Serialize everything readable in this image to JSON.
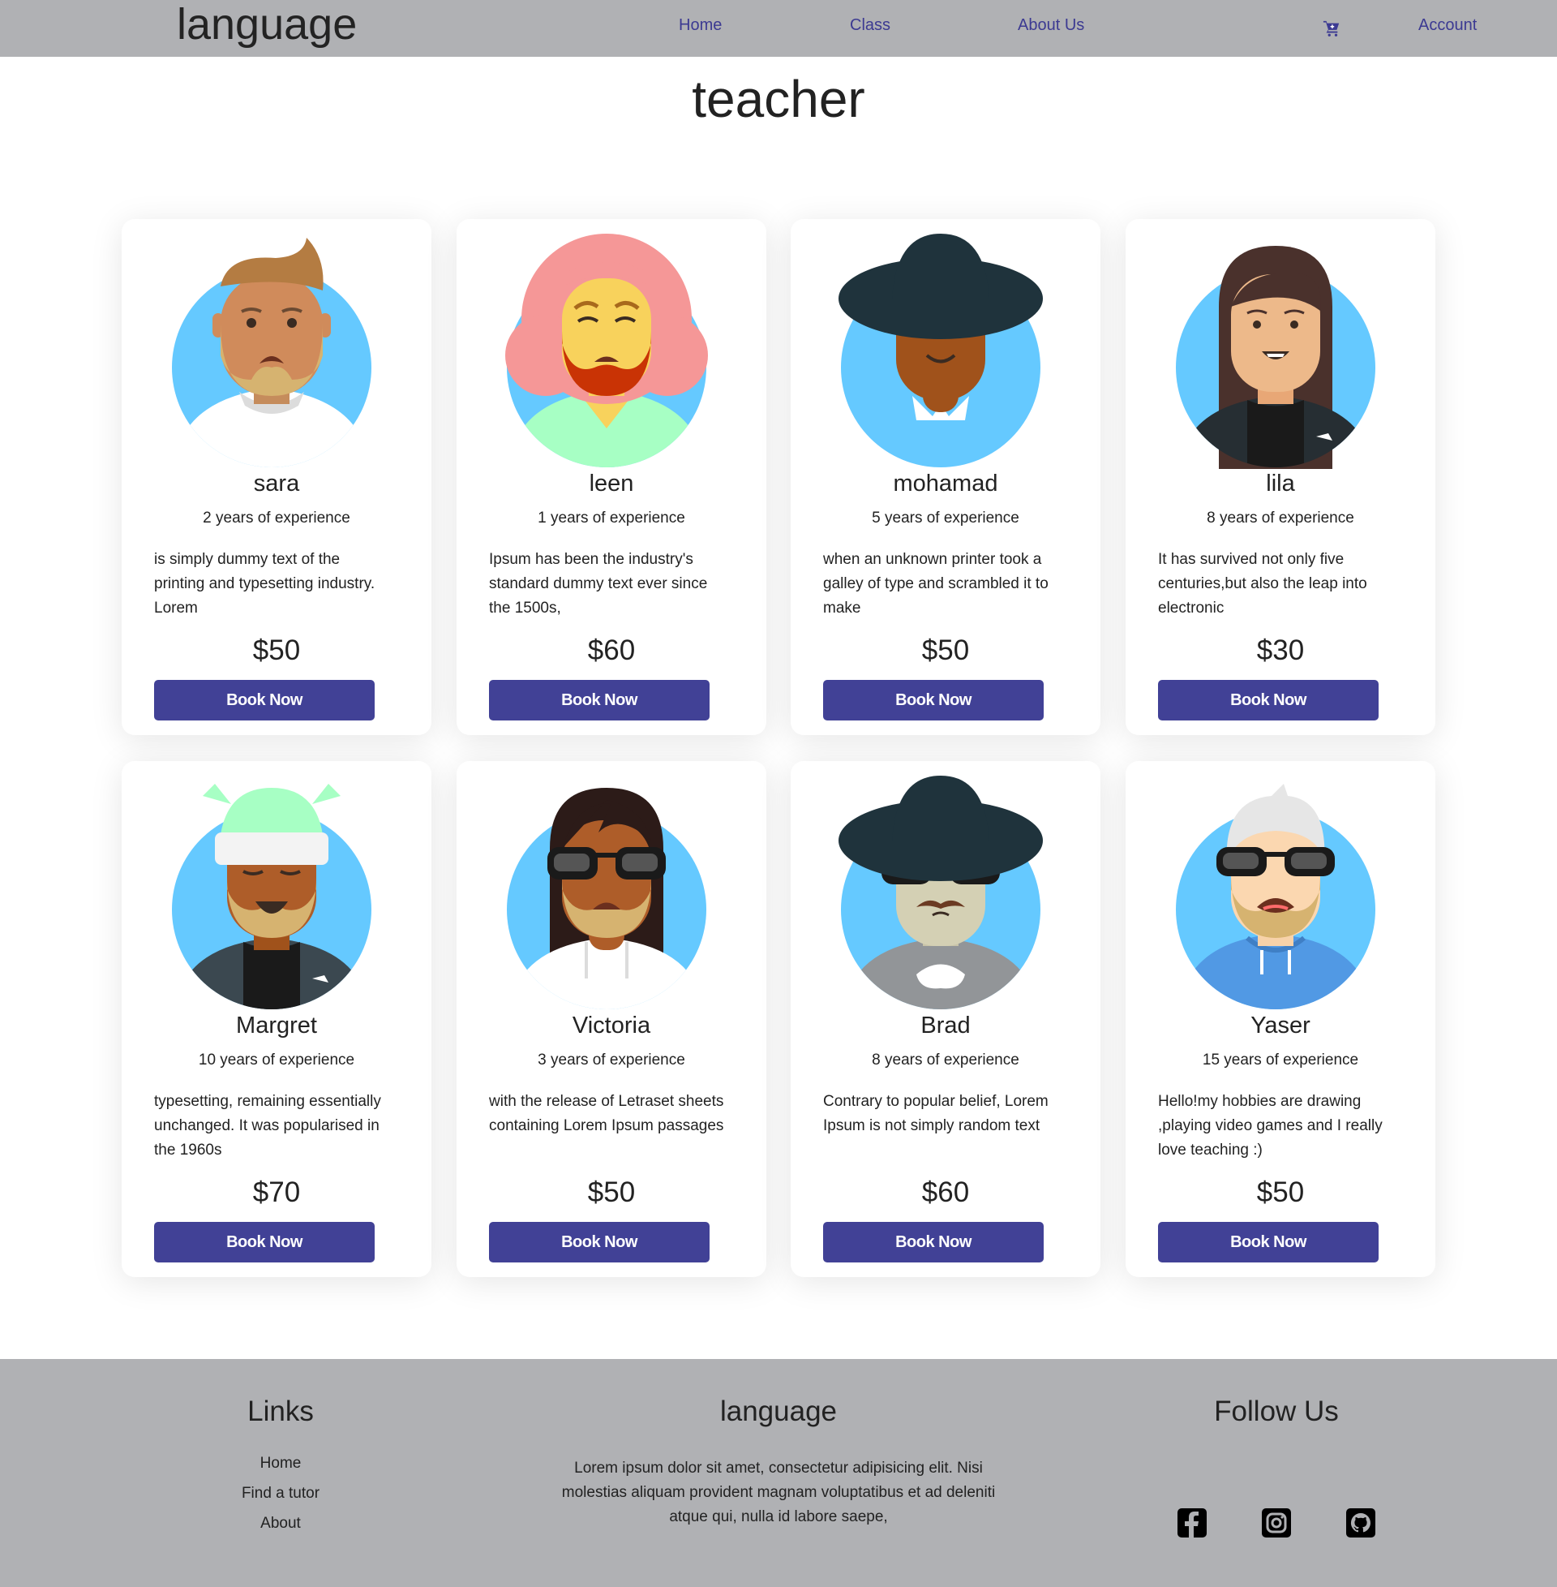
{
  "navbar": {
    "brand": "language",
    "links": {
      "home": "Home",
      "class": "Class",
      "about": "About Us",
      "account": "Account"
    },
    "cart_icon": "cart-icon"
  },
  "page": {
    "title": "teacher"
  },
  "colors": {
    "nav_bg": "#b0b1b4",
    "button_bg": "#414196",
    "link": "#3c3a92",
    "avatar_bg": "#65c9ff"
  },
  "teachers": [
    {
      "name": "sara",
      "experience": "2 years of experience",
      "description": "is simply dummy text of the printing and typesetting industry. Lorem",
      "price": "$50",
      "button": "Book Now"
    },
    {
      "name": "leen",
      "experience": "1 years of experience",
      "description": "Ipsum has been the industry's standard dummy text ever since the 1500s,",
      "price": "$60",
      "button": "Book Now"
    },
    {
      "name": "mohamad",
      "experience": "5 years of experience",
      "description": "when an unknown printer took a galley of type and scrambled it to make",
      "price": "$50",
      "button": "Book Now"
    },
    {
      "name": "lila",
      "experience": "8 years of experience",
      "description": "It has survived not only five centuries,but also the leap into electronic",
      "price": "$30",
      "button": "Book Now"
    },
    {
      "name": "Margret",
      "experience": "10 years of experience",
      "description": "typesetting, remaining essentially unchanged. It was popularised in the 1960s",
      "price": "$70",
      "button": "Book Now"
    },
    {
      "name": "Victoria",
      "experience": "3 years of experience",
      "description": "with the release of Letraset sheets containing Lorem Ipsum passages",
      "price": "$50",
      "button": "Book Now"
    },
    {
      "name": "Brad",
      "experience": "8 years of experience",
      "description": "Contrary to popular belief, Lorem Ipsum is not simply random text",
      "price": "$60",
      "button": "Book Now"
    },
    {
      "name": "Yaser",
      "experience": "15 years of experience",
      "description": "Hello!my hobbies are drawing ,playing video games and I really love teaching :)",
      "price": "$50",
      "button": "Book Now"
    }
  ],
  "footer": {
    "links_title": "Links",
    "links": [
      "Home",
      "Find a tutor",
      "About"
    ],
    "brand_title": "language",
    "brand_text": "Lorem ipsum dolor sit amet, consectetur adipisicing elit. Nisi molestias aliquam provident magnam voluptatibus et ad deleniti atque qui, nulla id labore saepe,",
    "follow_title": "Follow Us",
    "social_icons": [
      "facebook-icon",
      "instagram-icon",
      "github-icon"
    ]
  }
}
